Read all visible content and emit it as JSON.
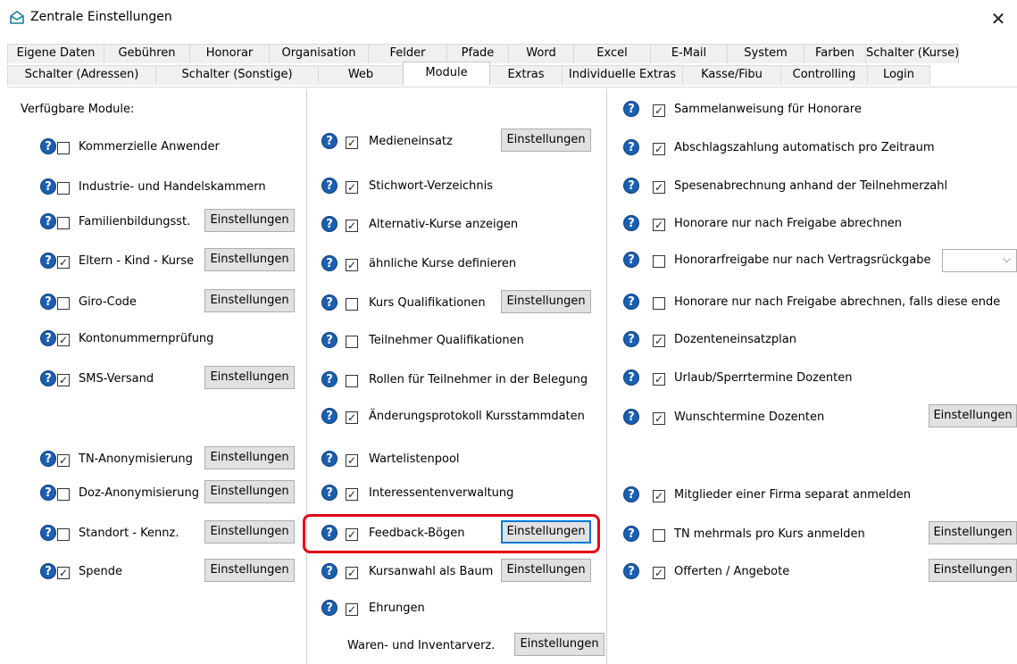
{
  "window": {
    "title": "Zentrale Einstellungen"
  },
  "tabs": {
    "row1": [
      "Eigene Daten",
      "Gebühren",
      "Honorar",
      "Organisation",
      "Felder",
      "Pfade",
      "Word",
      "Excel",
      "E-Mail",
      "System",
      "Farben",
      "Schalter (Kurse)"
    ],
    "row2": [
      "Schalter (Adressen)",
      "Schalter (Sonstige)",
      "Web",
      "Module",
      "Extras",
      "Individuelle Extras",
      "Kasse/Fibu",
      "Controlling",
      "Login"
    ],
    "active": "Module"
  },
  "heading": "Verfügbare Module:",
  "help_glyph": "?",
  "check_glyph": "✓",
  "button_label": "Einstellungen",
  "col1": [
    {
      "label": "Kommerzielle Anwender",
      "checked": false,
      "button": false
    },
    {
      "label": "Industrie- und Handelskammern",
      "checked": false,
      "button": false
    },
    {
      "label": "Familienbildungsst.",
      "checked": false,
      "button": true
    },
    {
      "label": "Eltern - Kind - Kurse",
      "checked": true,
      "button": true
    },
    {
      "label": "Giro-Code",
      "checked": false,
      "button": true
    },
    {
      "label": "Kontonummernprüfung",
      "checked": true,
      "button": false
    },
    {
      "label": "SMS-Versand",
      "checked": true,
      "button": true
    },
    {
      "label": "TN-Anonymisierung",
      "checked": true,
      "button": true
    },
    {
      "label": "Doz-Anonymisierung",
      "checked": false,
      "button": true
    },
    {
      "label": "Standort - Kennz.",
      "checked": false,
      "button": true
    },
    {
      "label": "Spende",
      "checked": true,
      "button": true
    }
  ],
  "col2": [
    {
      "label": "Medieneinsatz",
      "checked": true,
      "button": true
    },
    {
      "label": "Stichwort-Verzeichnis",
      "checked": true,
      "button": false
    },
    {
      "label": "Alternativ-Kurse anzeigen",
      "checked": true,
      "button": false
    },
    {
      "label": "ähnliche Kurse definieren",
      "checked": true,
      "button": false
    },
    {
      "label": "Kurs Qualifikationen",
      "checked": false,
      "button": true
    },
    {
      "label": "Teilnehmer Qualifikationen",
      "checked": false,
      "button": false
    },
    {
      "label": "Rollen für Teilnehmer in der Belegung",
      "checked": false,
      "button": false
    },
    {
      "label": "Änderungsprotokoll Kursstammdaten",
      "checked": true,
      "button": false
    },
    {
      "label": "Wartelistenpool",
      "checked": true,
      "button": false
    },
    {
      "label": "Interessentenverwaltung",
      "checked": true,
      "button": false
    },
    {
      "label": "Feedback-Bögen",
      "checked": true,
      "button": true
    },
    {
      "label": "Kursanwahl als Baum",
      "checked": true,
      "button": true
    },
    {
      "label": "Ehrungen",
      "checked": true,
      "button": false
    }
  ],
  "col2_footer": {
    "label": "Waren- und Inventarverz.",
    "button": true
  },
  "col3": [
    {
      "label": "Sammelanweisung für Honorare",
      "checked": true,
      "button": false
    },
    {
      "label": "Abschlagszahlung automatisch pro Zeitraum",
      "checked": true,
      "button": false
    },
    {
      "label": "Spesenabrechnung anhand der Teilnehmerzahl",
      "checked": true,
      "button": false
    },
    {
      "label": "Honorare nur nach Freigabe abrechnen",
      "checked": true,
      "button": false
    },
    {
      "label": "Honorarfreigabe nur nach Vertragsrückgabe",
      "checked": false,
      "button": false,
      "dropdown": ""
    },
    {
      "label": "Honorare nur nach Freigabe abrechnen, falls diese ende",
      "checked": false,
      "button": false
    },
    {
      "label": "Dozenteneinsatzplan",
      "checked": true,
      "button": false
    },
    {
      "label": "Urlaub/Sperrtermine Dozenten",
      "checked": true,
      "button": false
    },
    {
      "label": "Wunschtermine Dozenten",
      "checked": true,
      "button": true
    },
    {
      "label": "Mitglieder einer Firma separat anmelden",
      "checked": true,
      "button": false
    },
    {
      "label": "TN mehrmals pro Kurs anmelden",
      "checked": false,
      "button": true
    },
    {
      "label": "Offerten / Angebote",
      "checked": true,
      "button": true
    }
  ]
}
